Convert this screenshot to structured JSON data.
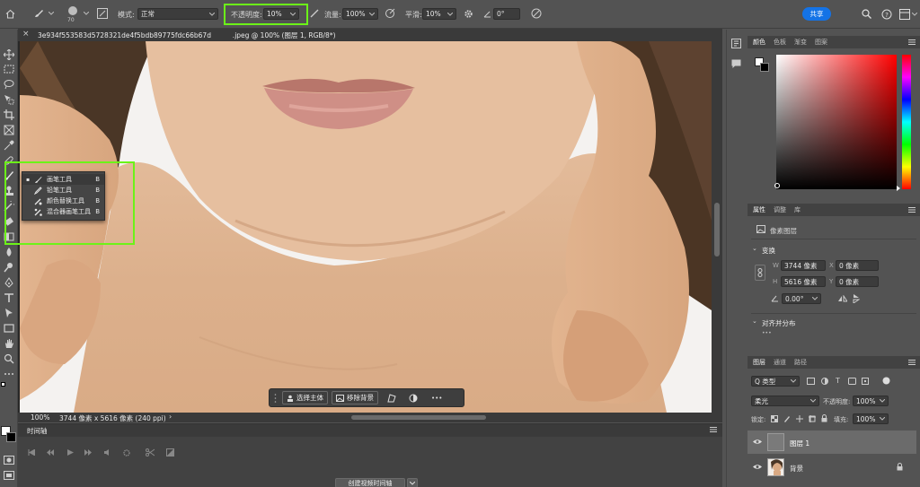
{
  "options_bar": {
    "brush_size": "70",
    "mode_label": "模式:",
    "mode_value": "正常",
    "opacity_label": "不透明度:",
    "opacity_value": "10%",
    "flow_label": "流量:",
    "flow_value": "100%",
    "smoothing_label": "平滑:",
    "smoothing_value": "10%",
    "angle_value": "0°",
    "share_label": "共享"
  },
  "document": {
    "tab_title": "3e934f553583d5728321de4f5bdb89775fdc66b67d          .jpeg @ 100% (图层 1, RGB/8*)",
    "close_mark": "×",
    "zoom": "100%",
    "info": "3744 像素 x 5616 像素 (240 ppi)",
    "info_arrow": "›"
  },
  "tool_flyout": {
    "items": [
      {
        "label": "画笔工具",
        "key": "B",
        "icon": "brush-icon",
        "selected": true
      },
      {
        "label": "铅笔工具",
        "key": "B",
        "icon": "pencil-icon",
        "selected": false
      },
      {
        "label": "颜色替换工具",
        "key": "B",
        "icon": "color-replace-icon",
        "selected": false
      },
      {
        "label": "混合器画笔工具",
        "key": "B",
        "icon": "mixer-brush-icon",
        "selected": false
      }
    ]
  },
  "contextual_bar": {
    "select_subject": "选择主体",
    "remove_bg": "移除背景",
    "more": "•••"
  },
  "timeline": {
    "title": "时间轴",
    "create_button": "创建视频时间轴"
  },
  "color_panel": {
    "tabs": [
      "颜色",
      "色板",
      "渐变",
      "图案"
    ],
    "accent_hue": "#ff0000"
  },
  "properties_panel": {
    "tabs": [
      "属性",
      "调整",
      "库"
    ],
    "pixel_layer": "像素图层",
    "transform_title": "变换",
    "w_label": "W",
    "w_value": "3744 像素",
    "x_label": "X",
    "x_value": "0 像素",
    "h_label": "H",
    "h_value": "5616 像素",
    "y_label": "Y",
    "y_value": "0 像素",
    "angle_value": "0.00°",
    "align_title": "对齐并分布",
    "more": "•••"
  },
  "layers_panel": {
    "tabs": [
      "图层",
      "通道",
      "路径"
    ],
    "filter_label": "Q 类型",
    "blend_mode": "柔光",
    "opacity_label": "不透明度:",
    "opacity_value": "100%",
    "lock_label": "锁定:",
    "fill_label": "填充:",
    "fill_value": "100%",
    "layers": [
      {
        "name": "图层 1",
        "selected": true
      },
      {
        "name": "背景",
        "selected": false
      }
    ]
  },
  "colors": {
    "highlight_green": "#6cf318",
    "share_blue": "#1473e6",
    "ui_gray": "#535353"
  }
}
